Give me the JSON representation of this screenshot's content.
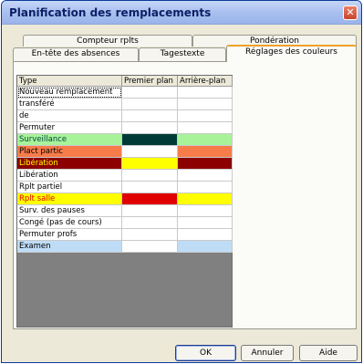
{
  "window": {
    "title": "Planification des remplacements",
    "close_glyph": "✕"
  },
  "tabs": {
    "row1": [
      {
        "label": "Compteur rplts"
      },
      {
        "label": "Pondération"
      }
    ],
    "row2": [
      {
        "label": "En-tête des absences"
      },
      {
        "label": "Tagestexte"
      },
      {
        "label": "Réglages des couleurs",
        "active": true
      }
    ]
  },
  "grid": {
    "headers": {
      "type": "Type",
      "premier": "Premier plan",
      "arriere": "Arrière-plan"
    },
    "rows": [
      {
        "label": "Nouveau remplacement",
        "label_bg": "#ffffff",
        "label_color": "#000000",
        "fg": "#ffffff",
        "bg": "#ffffff",
        "selected": true
      },
      {
        "label": "transféré",
        "label_bg": "#ffffff",
        "label_color": "#000000",
        "fg": "#ffffff",
        "bg": "#ffffff"
      },
      {
        "label": "de",
        "label_bg": "#ffffff",
        "label_color": "#000000",
        "fg": "#ffffff",
        "bg": "#ffffff"
      },
      {
        "label": "Permuter",
        "label_bg": "#ffffff",
        "label_color": "#000000",
        "fg": "#ffffff",
        "bg": "#ffffff"
      },
      {
        "label": "Surveillance",
        "label_bg": "#a8f29a",
        "label_color": "#004a40",
        "fg": "#003a36",
        "bg": "#a8f29a"
      },
      {
        "label": "Plact partic",
        "label_bg": "#f77c4a",
        "label_color": "#000000",
        "fg": "#ffffff",
        "bg": "#f77c4a"
      },
      {
        "label": "Libération",
        "label_bg": "#8c0000",
        "label_color": "#ffff00",
        "fg": "#ffff00",
        "bg": "#8c0000"
      },
      {
        "label": "Libération",
        "label_bg": "#ffffff",
        "label_color": "#000000",
        "fg": "#ffffff",
        "bg": "#ffffff"
      },
      {
        "label": "Rplt partiel",
        "label_bg": "#ffffff",
        "label_color": "#000000",
        "fg": "#ffffff",
        "bg": "#ffffff"
      },
      {
        "label": "Rplt salle",
        "label_bg": "#ffff00",
        "label_color": "#e00000",
        "fg": "#e00000",
        "bg": "#ffff00"
      },
      {
        "label": "Surv. des pauses",
        "label_bg": "#ffffff",
        "label_color": "#000000",
        "fg": "#ffffff",
        "bg": "#ffffff"
      },
      {
        "label": "Congé (pas de cours)",
        "label_bg": "#ffffff",
        "label_color": "#000000",
        "fg": "#ffffff",
        "bg": "#ffffff"
      },
      {
        "label": "Permuter profs",
        "label_bg": "#ffffff",
        "label_color": "#000000",
        "fg": "#ffffff",
        "bg": "#ffffff"
      },
      {
        "label": "Examen",
        "label_bg": "#bfdcf7",
        "label_color": "#000000",
        "fg": "#ffffff",
        "bg": "#bfdcf7"
      }
    ]
  },
  "buttons": {
    "ok": "OK",
    "annuler": "Annuler",
    "aide": "Aide"
  }
}
